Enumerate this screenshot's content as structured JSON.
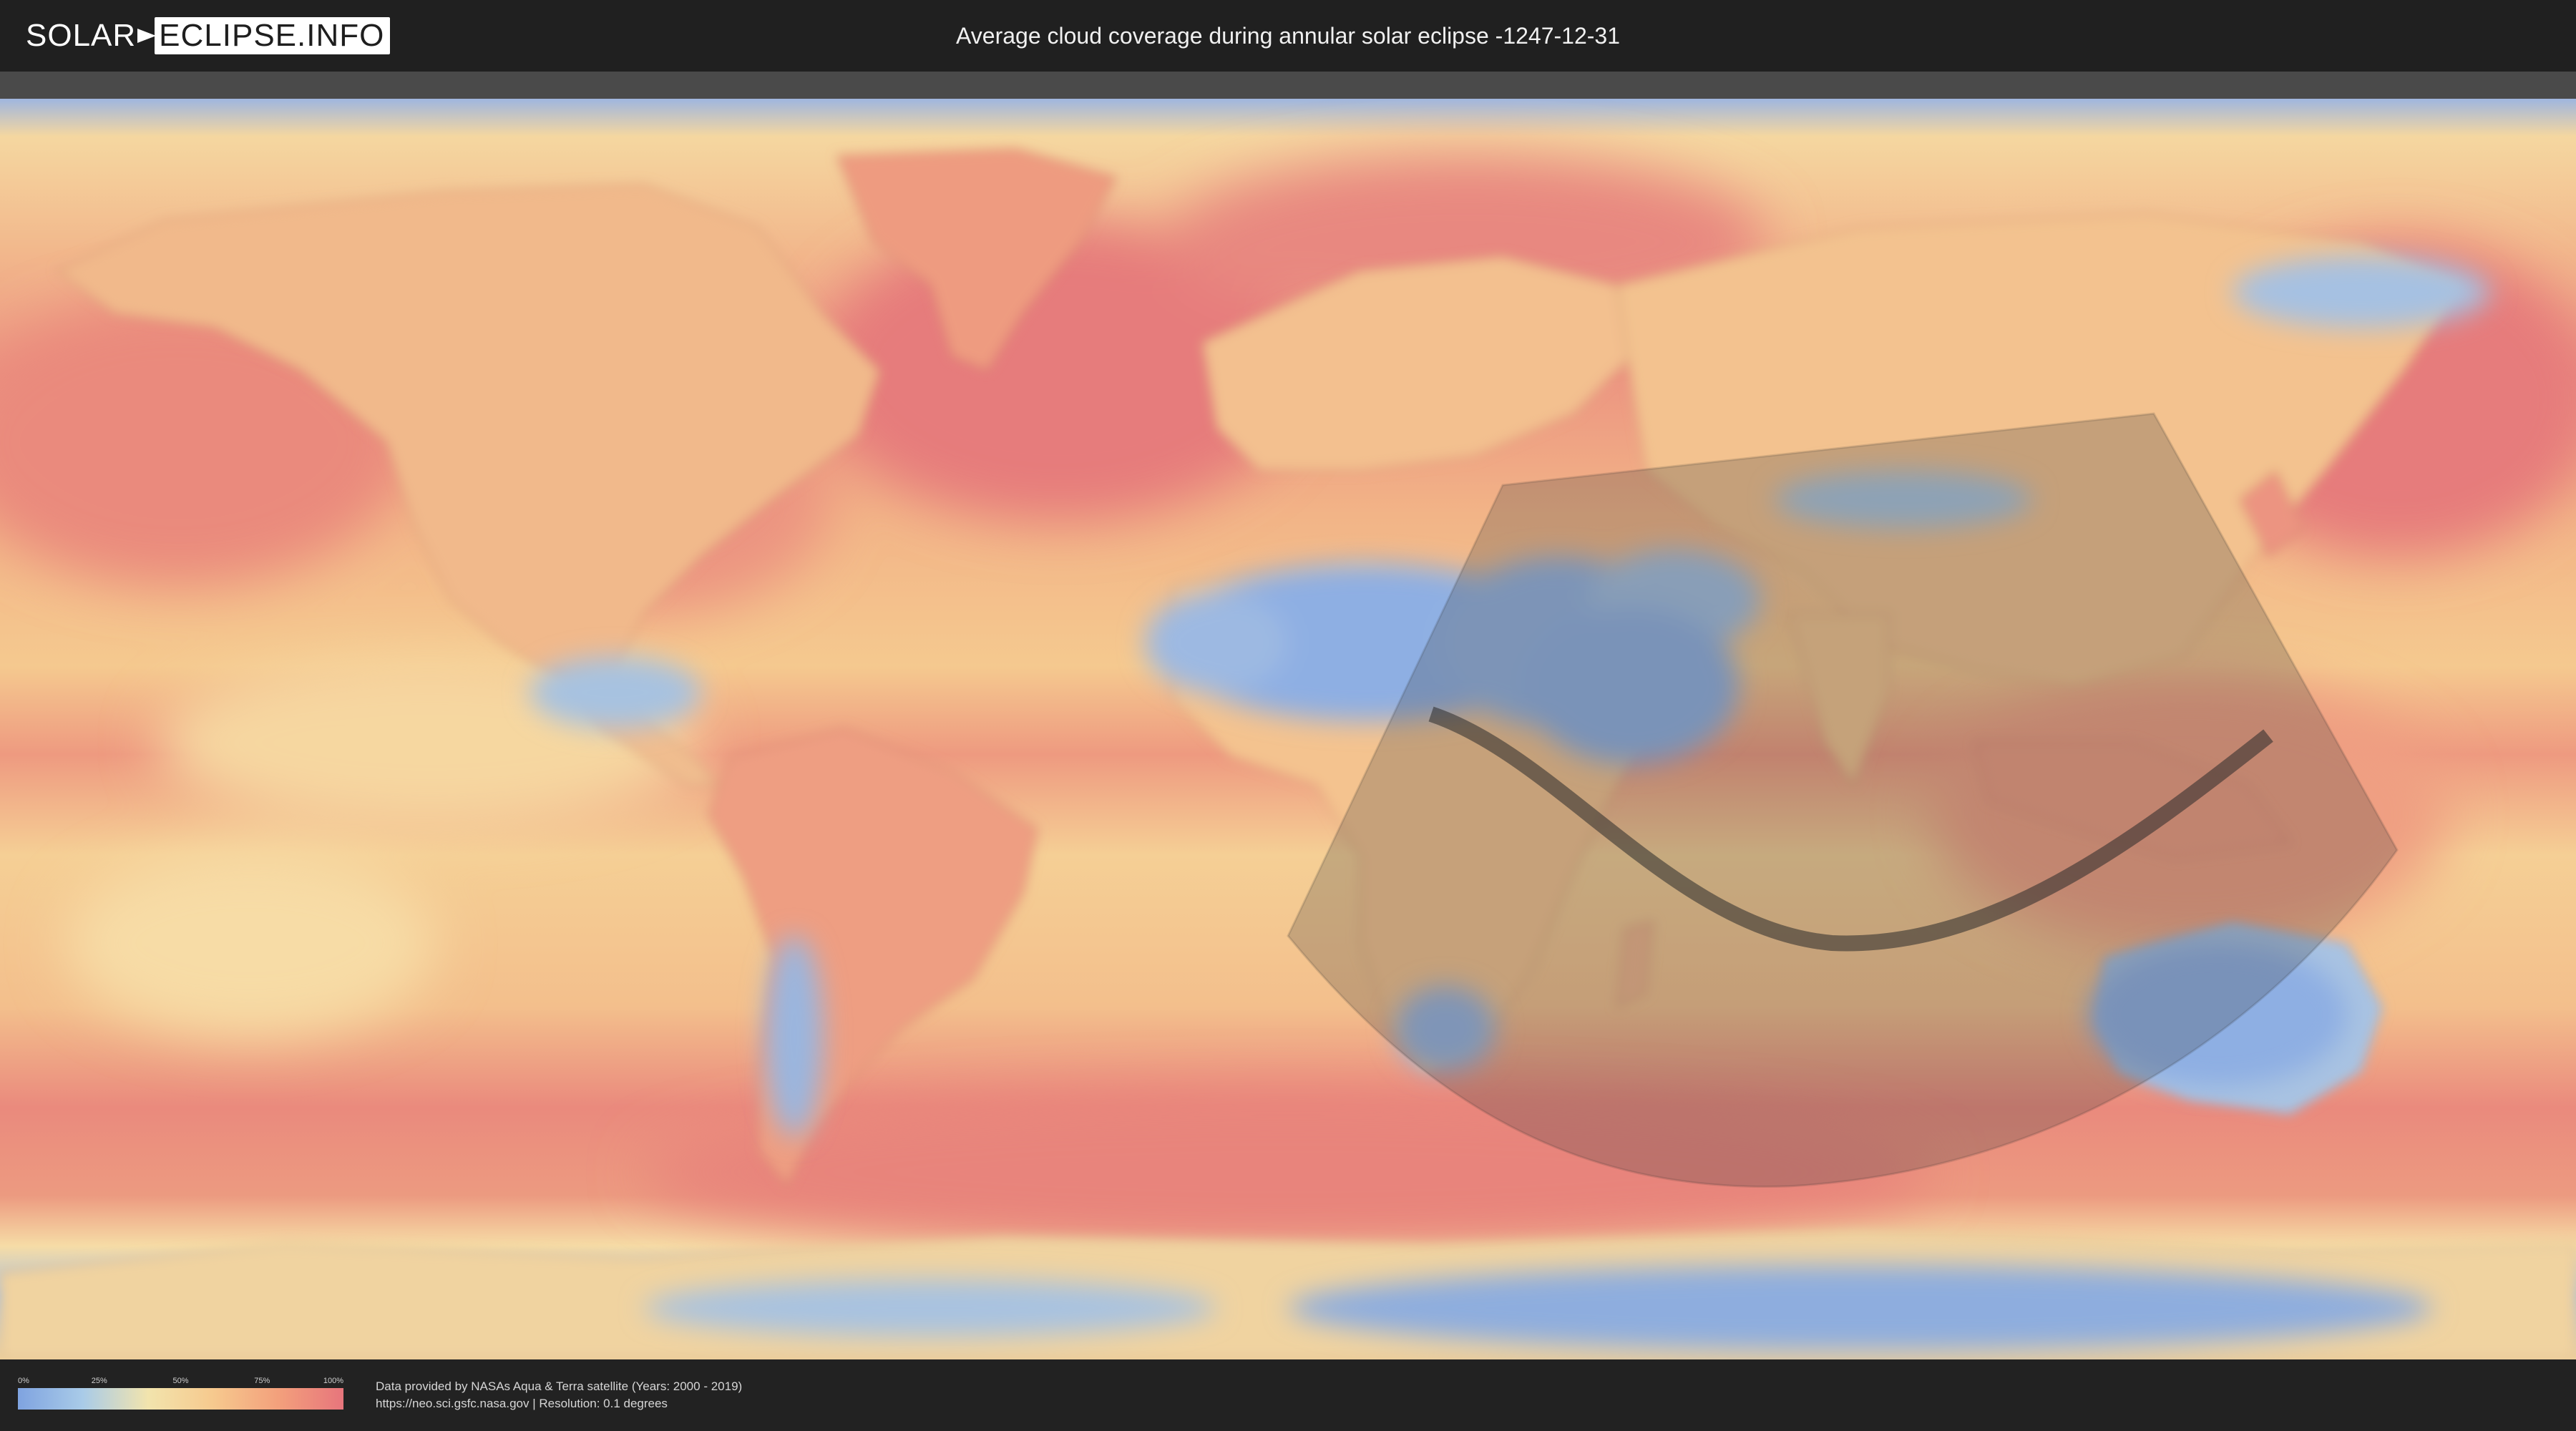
{
  "header": {
    "logo_left": "SOLAR",
    "logo_right": "ECLIPSE.INFO",
    "title": "Average cloud coverage during annular solar eclipse -1247-12-31"
  },
  "legend": {
    "ticks": [
      "0%",
      "25%",
      "50%",
      "75%",
      "100%"
    ],
    "colors": [
      "#7fa3e0",
      "#a9cbe8",
      "#f2e4ad",
      "#f6c98e",
      "#f3a07c",
      "#e7757c"
    ]
  },
  "footer": {
    "credit_line1": "Data provided by NASAs Aqua & Terra satellite (Years: 2000 - 2019)",
    "credit_line2": "https://neo.sci.gsfc.nasa.gov | Resolution: 0.1 degrees"
  },
  "colors": {
    "ocean_cloudy": "#ea8a7d",
    "ocean_mid": "#f4c38f",
    "clear_sky": "#8fb0e2",
    "partial": "#c7d8dc",
    "shadow": "#2a2a2a"
  }
}
